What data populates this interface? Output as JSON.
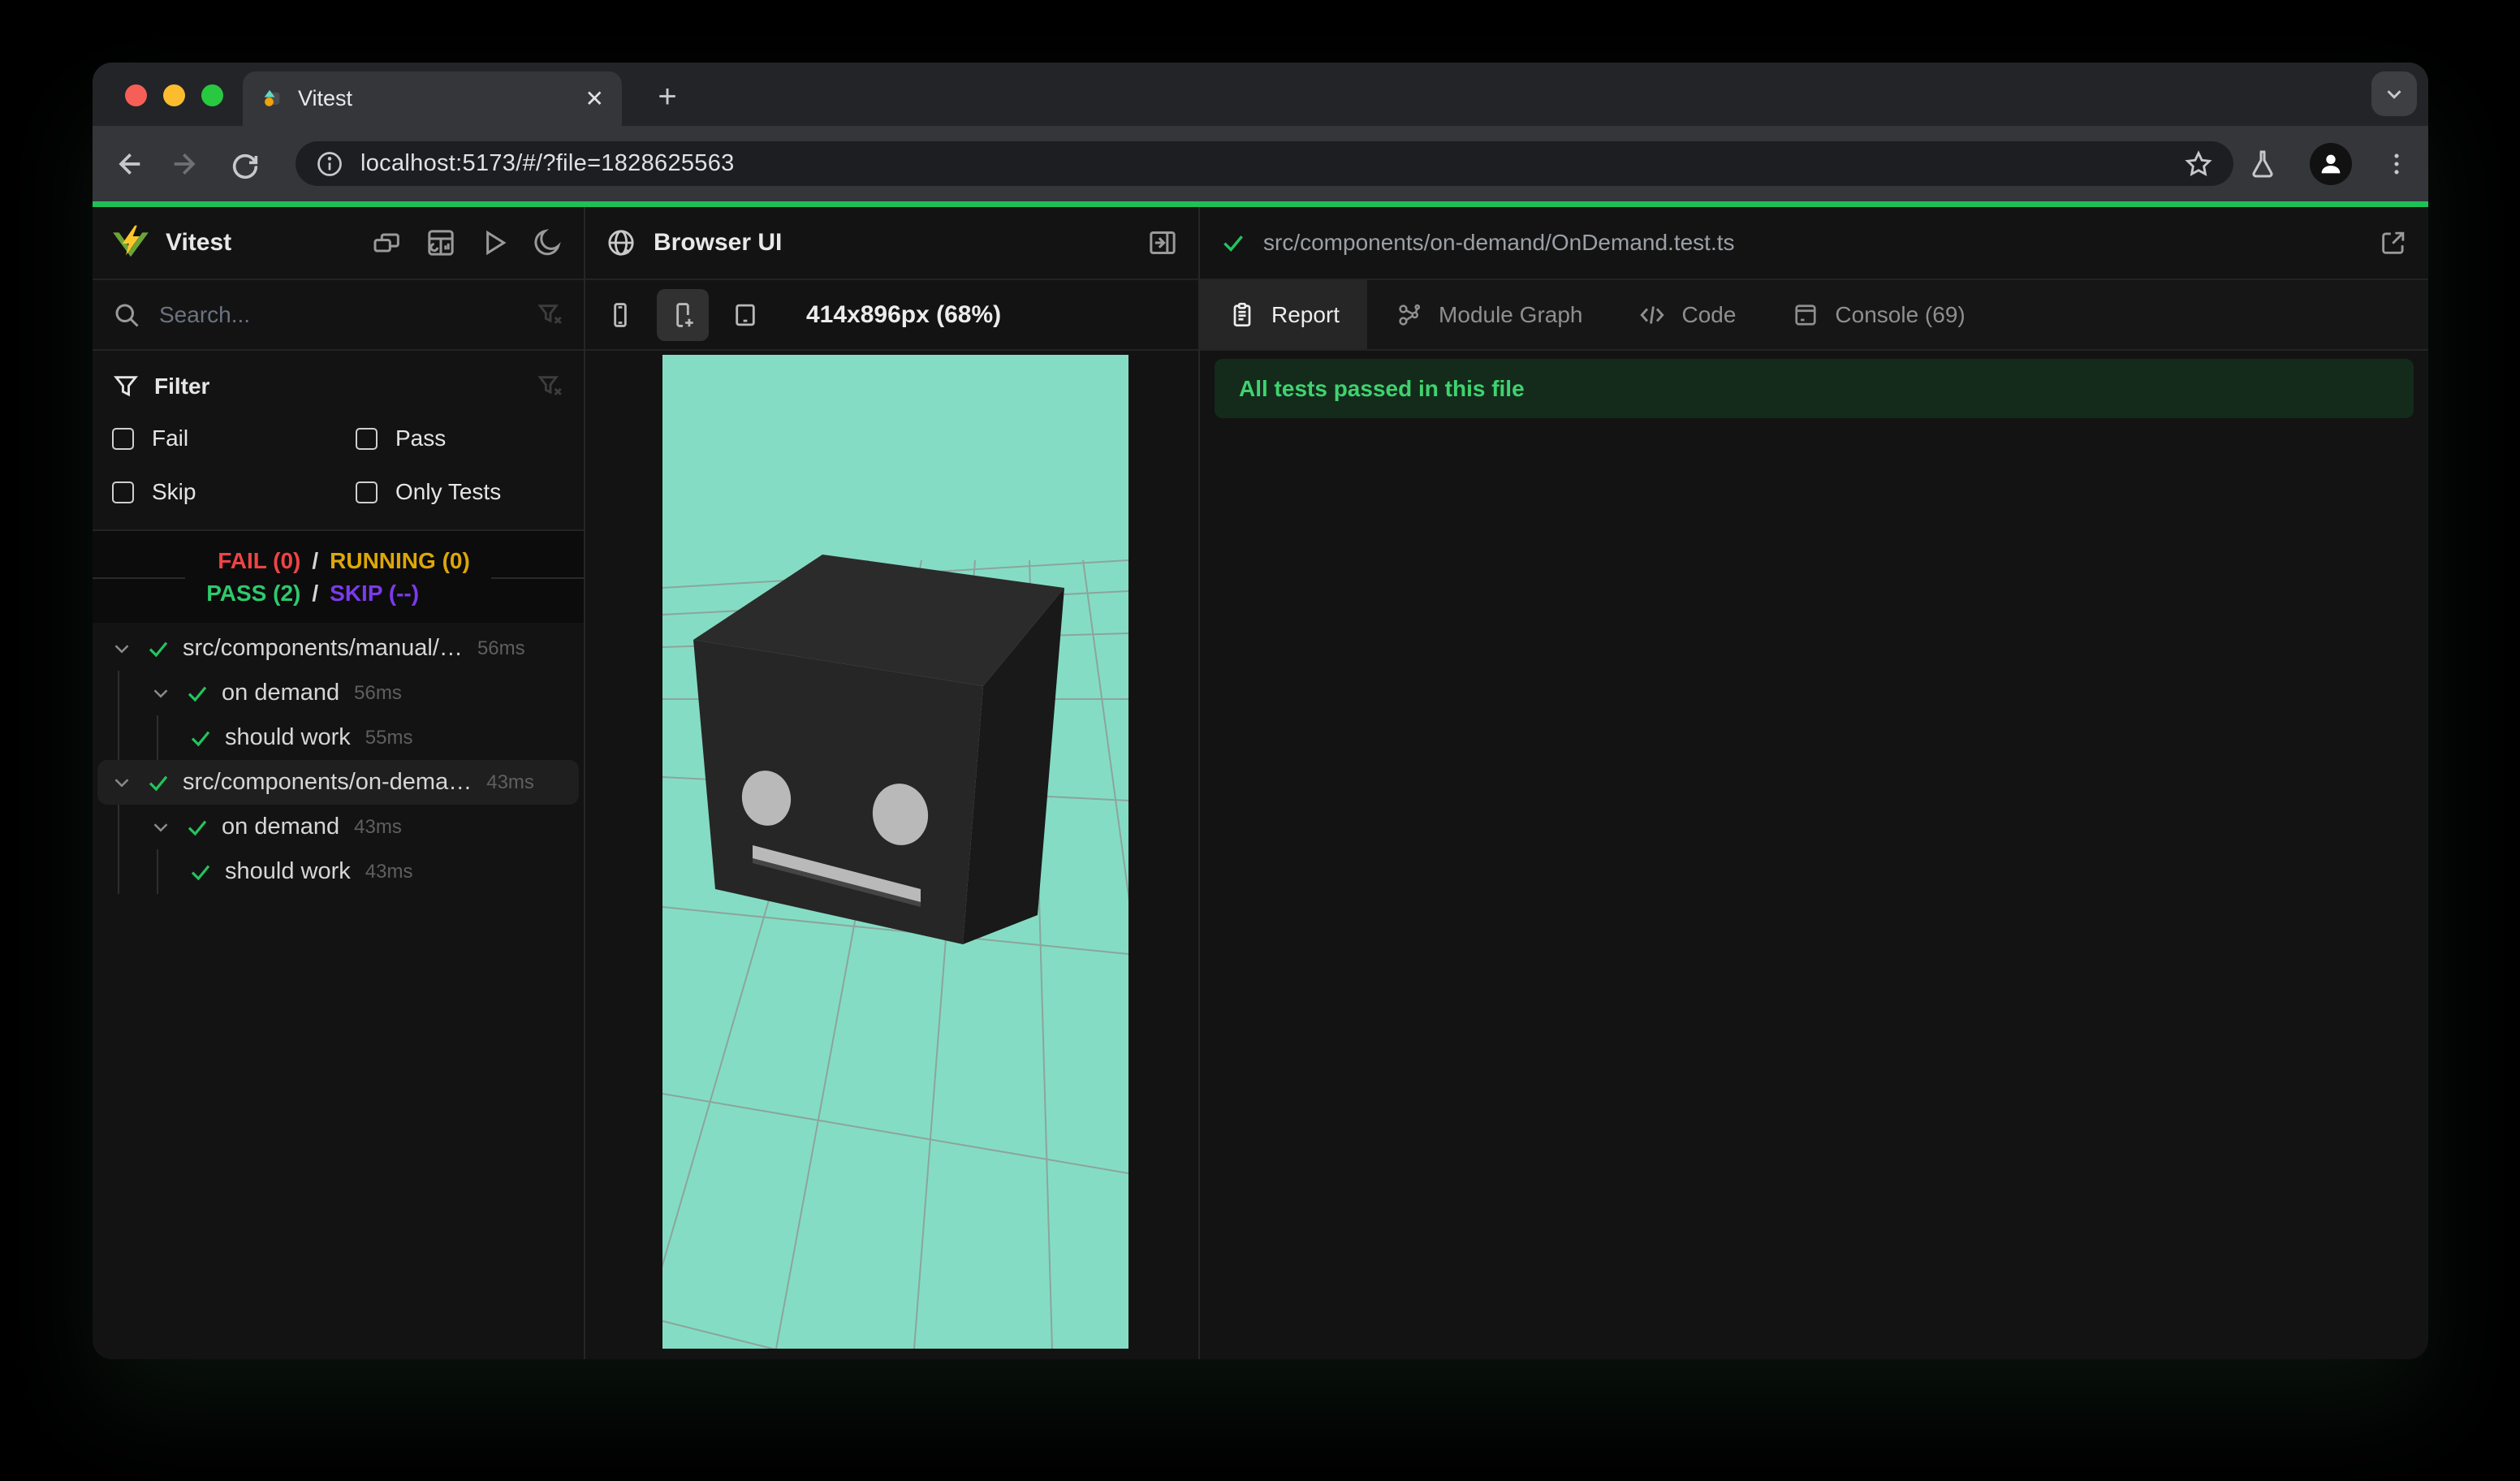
{
  "browser": {
    "tab_title": "Vitest",
    "close_glyph": "✕",
    "new_tab_glyph": "+",
    "url": "localhost:5173/#/?file=1828625563"
  },
  "vitest": {
    "title": "Vitest",
    "search_placeholder": "Search...",
    "filter": {
      "label": "Filter",
      "fail": "Fail",
      "pass": "Pass",
      "skip": "Skip",
      "only_tests": "Only Tests"
    },
    "summary": {
      "fail": "FAIL (0)",
      "sep": "/",
      "running": "RUNNING (0)",
      "pass": "PASS (2)",
      "skip": "SKIP (--)"
    },
    "tree": {
      "rows": [
        {
          "label": "src/components/manual/…",
          "duration": "56ms"
        },
        {
          "label": "on demand",
          "duration": "56ms"
        },
        {
          "label": "should work",
          "duration": "55ms"
        },
        {
          "label": "src/components/on-dema…",
          "duration": "43ms"
        },
        {
          "label": "on demand",
          "duration": "43ms"
        },
        {
          "label": "should work",
          "duration": "43ms"
        }
      ]
    }
  },
  "browser_panel": {
    "title": "Browser UI",
    "viewport_label": "414x896px (68%)"
  },
  "report_panel": {
    "file_path": "src/components/on-demand/OnDemand.test.ts",
    "tabs": {
      "report": "Report",
      "module_graph": "Module Graph",
      "code": "Code",
      "console": "Console (69)"
    },
    "banner": "All tests passed in this file"
  },
  "colors": {
    "progress_green": "#1ec158",
    "check_green": "#23c45e",
    "fail_red": "#ef4444",
    "running_yellow": "#dda708",
    "pass_green": "#2fc96c",
    "skip_purple": "#7c3aed",
    "viewport_teal": "#85dcc4"
  }
}
